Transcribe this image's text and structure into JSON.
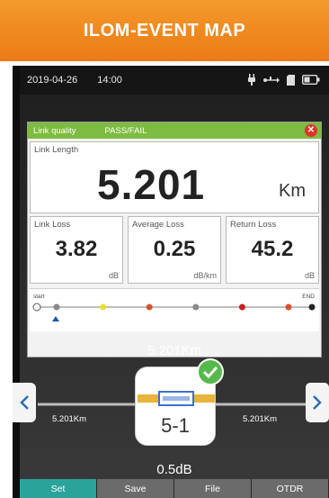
{
  "header": {
    "title": "ILOM-EVENT MAP"
  },
  "status": {
    "date": "2019-04-26",
    "time": "14:00",
    "icons": [
      "plug-icon",
      "usb-icon",
      "sd-card-icon",
      "battery-icon"
    ]
  },
  "quality": {
    "label": "Link quality",
    "result": "PASS/FAIL",
    "close_icon": "close-icon"
  },
  "link_length": {
    "label": "Link Length",
    "value": "5.201",
    "unit": "Km"
  },
  "metrics": [
    {
      "label": "Link Loss",
      "value": "3.82",
      "unit": "dB"
    },
    {
      "label": "Average Loss",
      "value": "0.25",
      "unit": "dB/km"
    },
    {
      "label": "Return Loss",
      "value": "45.2",
      "unit": "dB"
    }
  ],
  "strip": {
    "start_label": "start",
    "end_label": "END",
    "events": [
      "#888888",
      "#e8e030",
      "#d9512c",
      "#8a8a8a",
      "#c91f1f",
      "#d9512c"
    ]
  },
  "event_view": {
    "distance_top": "5.201Km",
    "left_distance": "5.201Km",
    "right_distance": "5.201Km",
    "event_id": "5-1",
    "event_loss": "0.5dB"
  },
  "tabs": [
    "Set",
    "Save",
    "File",
    "OTDR"
  ],
  "colors": {
    "banner": "#ec7a16",
    "pass": "#7dbb42",
    "tab_active": "#2aa39b",
    "check": "#56b94b"
  }
}
